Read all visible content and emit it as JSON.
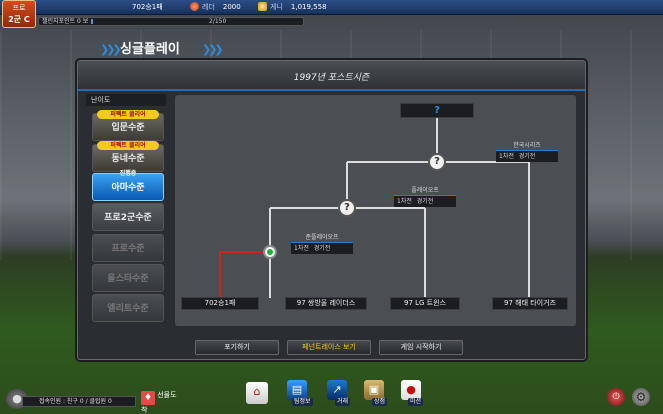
{
  "team_badge": {
    "line1": "프로",
    "line2": "2군 C"
  },
  "topbar": {
    "wins": "702승1패",
    "rating_label": "레더",
    "rating_value": "2000",
    "money_label": "게니",
    "money_value": "1,019,558"
  },
  "exp": {
    "label": "챌린지포인트 0 보",
    "value": "2/150",
    "progress": 0.01
  },
  "title": "싱글플레이",
  "panel": {
    "header": "1997년 포스트시즌"
  },
  "difficulty": {
    "title": "난이도",
    "perfect_tag": "퍼펙트 클리어",
    "progress_tag": "진행중",
    "items": [
      {
        "label": "입문수준",
        "state": "cleared"
      },
      {
        "label": "동네수준",
        "state": "cleared"
      },
      {
        "label": "아마수준",
        "state": "current"
      },
      {
        "label": "프로2군수준",
        "state": "unlocked"
      },
      {
        "label": "프로수준",
        "state": "locked"
      },
      {
        "label": "올스타수준",
        "state": "locked"
      },
      {
        "label": "엘리트수준",
        "state": "locked"
      }
    ]
  },
  "bracket": {
    "final": "?",
    "rounds": [
      {
        "title": "준플레이오프",
        "sub": "1차전 경기전"
      },
      {
        "title": "플레이오프",
        "sub": "1차전 경기전"
      },
      {
        "title": "한국시리즈",
        "sub": "1차전 경기전"
      }
    ],
    "teams": [
      "702승1패",
      "97 쌍방울 레이더스",
      "97 LG 트윈스",
      "97 해태 타이거즈"
    ],
    "unknown": "?"
  },
  "actions": {
    "forfeit": "포기하기",
    "view_pennant": "페넌트레이스 보기",
    "start_game": "게임 시작하기"
  },
  "bottom": {
    "friends": "접속인원 : 친구 0 / 클럽원 0",
    "gift": "선물도착",
    "dock": [
      "",
      "팀정보",
      "거래",
      "상점",
      "미션"
    ]
  },
  "colors": {
    "accent": "#2c7bd0",
    "win_path": "#d42020",
    "current_level": "#1a7de0"
  }
}
